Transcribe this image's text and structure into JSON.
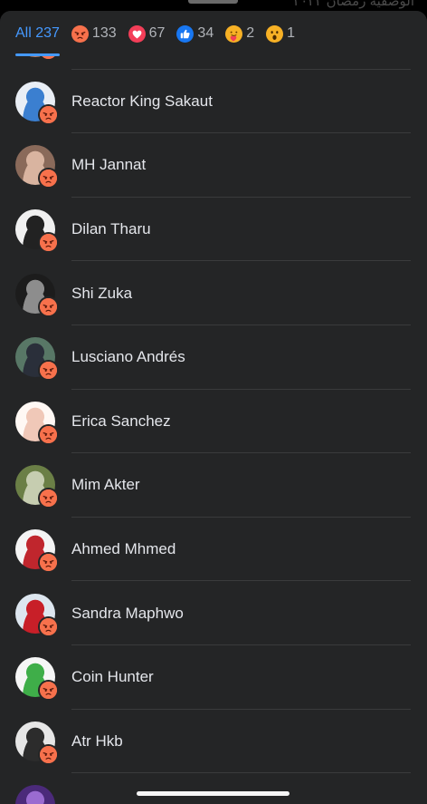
{
  "background_text": "الوصفية   رمضان ٢٠٢٢",
  "tabs": [
    {
      "label": "All 237",
      "icon": null,
      "active": true
    },
    {
      "label": "133",
      "icon": "angry-reaction-icon"
    },
    {
      "label": "67",
      "icon": "love-reaction-icon"
    },
    {
      "label": "34",
      "icon": "like-reaction-icon"
    },
    {
      "label": "2",
      "icon": "care-reaction-icon"
    },
    {
      "label": "1",
      "icon": "wow-reaction-icon"
    }
  ],
  "people": [
    {
      "name": "",
      "avatar_colors": [
        "#7a4a3a",
        "#c08060"
      ]
    },
    {
      "name": "Reactor King Sakaut",
      "avatar_colors": [
        "#e9eef5",
        "#3b7fd0"
      ]
    },
    {
      "name": "MH Jannat",
      "avatar_colors": [
        "#8a6a5a",
        "#d9b4a0"
      ]
    },
    {
      "name": "Dilan Tharu",
      "avatar_colors": [
        "#f0f0f0",
        "#222222"
      ]
    },
    {
      "name": "Shi Zuka",
      "avatar_colors": [
        "#1c1c1c",
        "#8d8d8d"
      ]
    },
    {
      "name": "Lusciano Andrés",
      "avatar_colors": [
        "#587766",
        "#2a2f3a"
      ]
    },
    {
      "name": "Erica Sanchez",
      "avatar_colors": [
        "#fff8f4",
        "#f0c8b8"
      ]
    },
    {
      "name": "Mim Akter",
      "avatar_colors": [
        "#6b7f46",
        "#c6cdb0"
      ]
    },
    {
      "name": "Ahmed Mhmed",
      "avatar_colors": [
        "#f4f4f4",
        "#c0262d"
      ]
    },
    {
      "name": "Sandra Maphwo",
      "avatar_colors": [
        "#dde6ef",
        "#c81f28"
      ]
    },
    {
      "name": "Coin Hunter",
      "avatar_colors": [
        "#f6f6f6",
        "#3fae49"
      ]
    },
    {
      "name": "Atr Hkb",
      "avatar_colors": [
        "#e6e6e6",
        "#2c2c2c"
      ]
    },
    {
      "name": "",
      "avatar_colors": [
        "#4b2a7a",
        "#9a6bd0"
      ]
    }
  ],
  "colors": {
    "sheet": "#242526",
    "accent": "#4599ff",
    "angry": "#f7714c",
    "love": "#f33e58",
    "like": "#1877f2",
    "care": "#f7b125",
    "wow": "#f7b125"
  }
}
